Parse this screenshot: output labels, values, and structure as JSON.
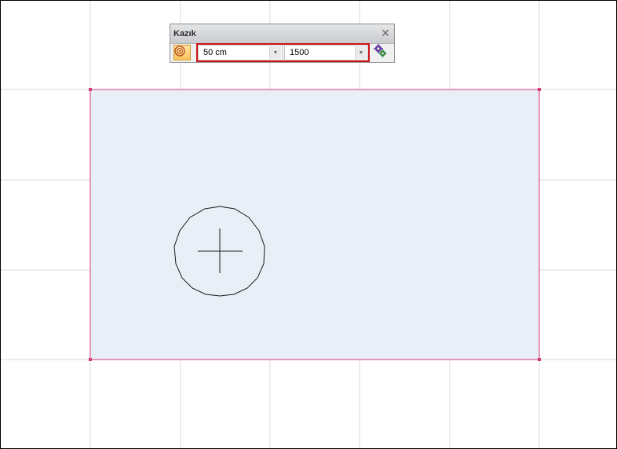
{
  "toolbar": {
    "title": "Kazık",
    "close_glyph": "✕",
    "pile_type_icon": "pile-circle-icon",
    "diameter": {
      "value": "50 cm",
      "arrow_glyph": "▼"
    },
    "length": {
      "value": "1500",
      "arrow_glyph": "▼"
    },
    "settings_icon": "gears-icon"
  },
  "colors": {
    "grid": "#d9d9e6",
    "slab_fill": "#e8eff7",
    "slab_border": "#d23a7a",
    "pile": "#1a1a1a",
    "highlight": "#d0141a",
    "pile_button": "#fcc45d"
  }
}
